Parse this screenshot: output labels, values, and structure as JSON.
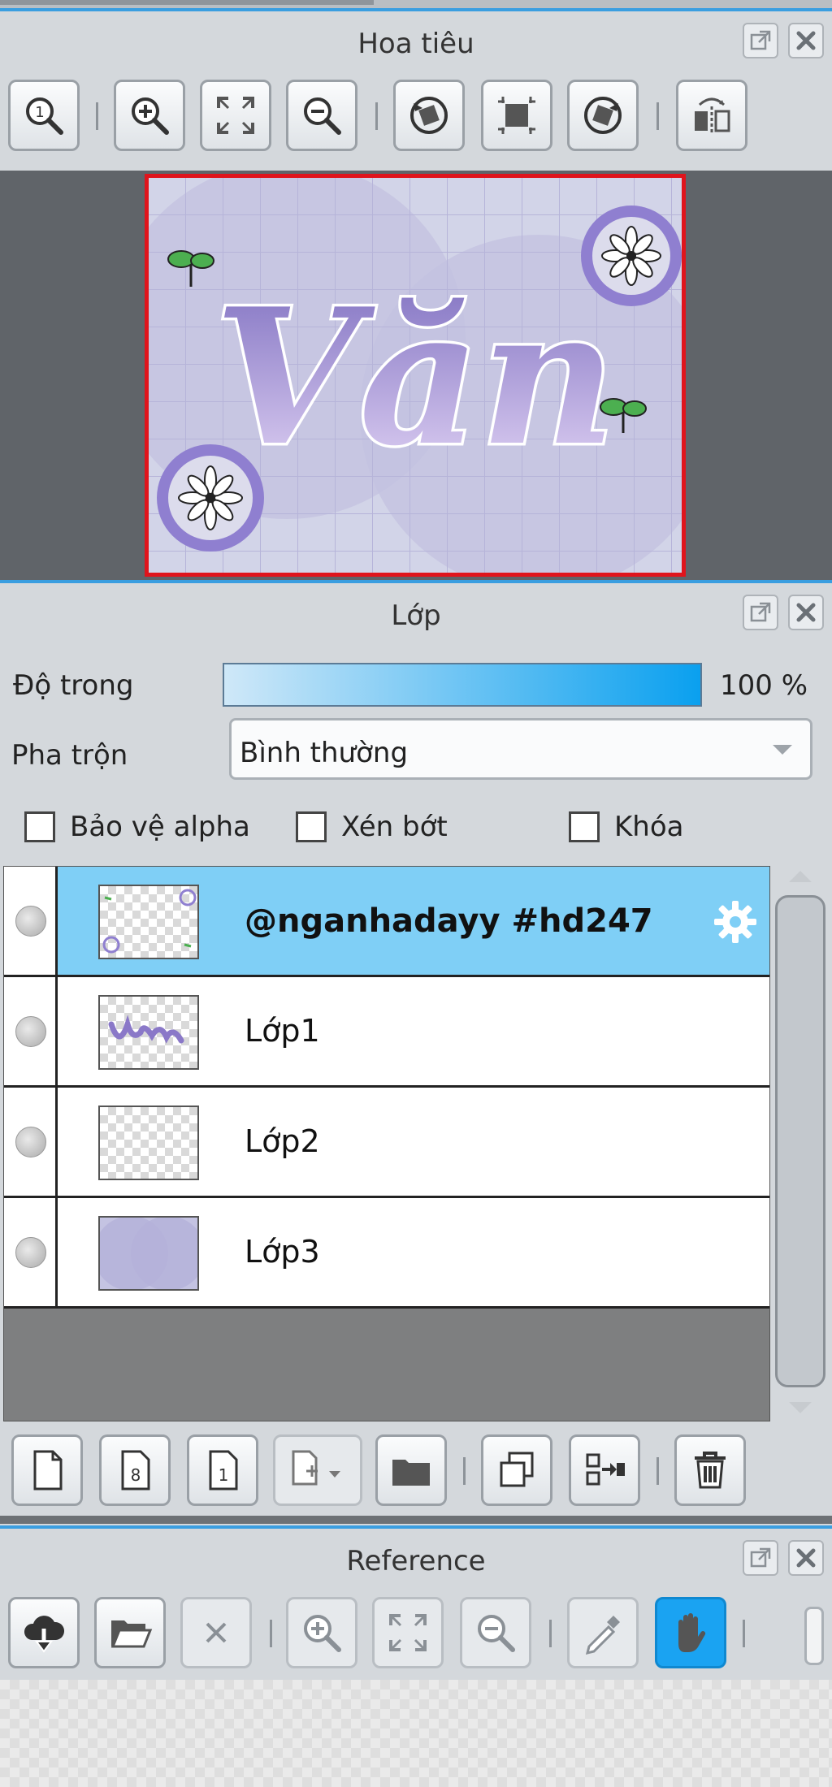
{
  "navigator": {
    "title": "Hoa tiêu",
    "header_icons": [
      "popout-icon",
      "close-icon"
    ],
    "toolbar_icons": [
      "zoom-actual-icon",
      "zoom-in-icon",
      "fit-screen-icon",
      "zoom-out-icon",
      "rotate-left-icon",
      "reset-view-icon",
      "rotate-right-icon",
      "flip-horizontal-icon"
    ],
    "preview_text": "Văn"
  },
  "layers": {
    "title": "Lớp",
    "opacity_label": "Độ trong",
    "opacity_value": "100 %",
    "opacity_level": 1.0,
    "blend_label": "Pha trộn",
    "blend_value": "Bình thường",
    "options": [
      {
        "label": "Bảo vệ alpha",
        "checked": false
      },
      {
        "label": "Xén bớt",
        "checked": false
      },
      {
        "label": "Khóa",
        "checked": false
      }
    ],
    "items": [
      {
        "name": "@nganhadayy #hd247",
        "selected": true
      },
      {
        "name": "Lớp1",
        "selected": false
      },
      {
        "name": "Lớp2",
        "selected": false
      },
      {
        "name": "Lớp3",
        "selected": false
      }
    ],
    "footer_icons": [
      "new-layer-icon",
      "new-8bit-layer-icon",
      "new-1bit-layer-icon",
      "add-layer-dropdown-icon",
      "new-folder-icon",
      "duplicate-layer-icon",
      "merge-down-icon",
      "delete-layer-icon"
    ]
  },
  "reference": {
    "title": "Reference",
    "toolbar_icons": [
      "import-cloud-icon",
      "open-folder-icon",
      "close-icon",
      "zoom-in-icon",
      "fit-screen-icon",
      "zoom-out-icon",
      "eyedropper-icon",
      "hand-icon"
    ],
    "active_tool": "hand-icon"
  },
  "colors": {
    "accent": "#3a9ee0",
    "selected_row": "#7fcff6",
    "active_tool": "#1aa3f2",
    "lettering_purple": "#8a78c8"
  }
}
